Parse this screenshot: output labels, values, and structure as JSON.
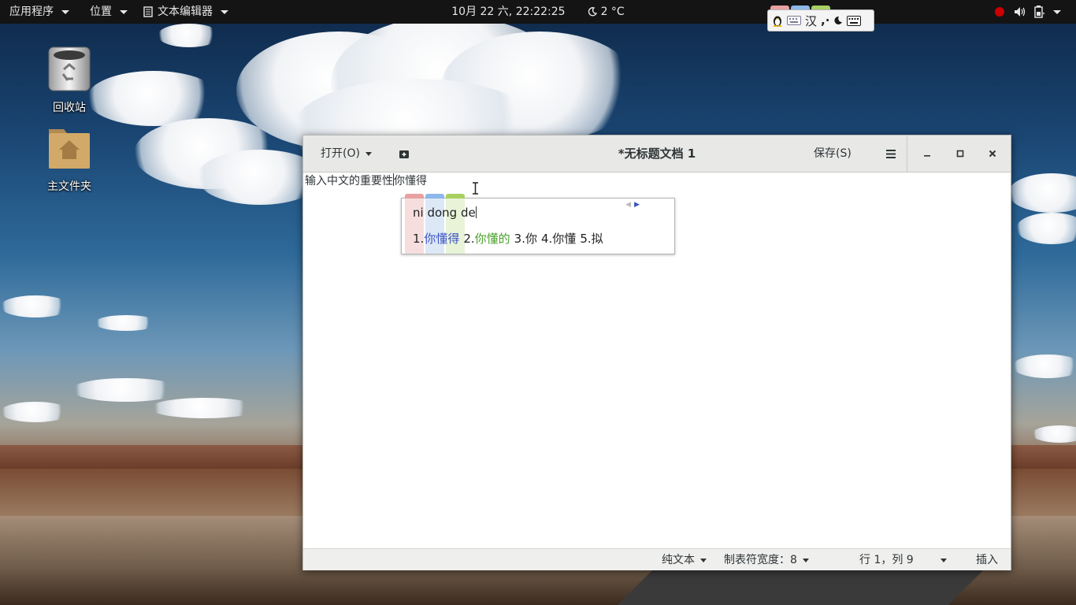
{
  "topbar": {
    "applications": "应用程序",
    "places": "位置",
    "app_name": "文本编辑器",
    "clock": "10月 22 六, 22:22:25",
    "weather": "2 °C",
    "colors": {
      "background": "#141414",
      "text": "#e8e8e8",
      "record": "#cc0000"
    }
  },
  "ime_toolbar": {
    "mode": "汉",
    "punct": ",·",
    "icons": [
      "penguin-icon",
      "soft-keyboard-icon",
      "moon-icon",
      "keyboard-icon"
    ]
  },
  "desktop": {
    "trash_label": "回收站",
    "home_label": "主文件夹"
  },
  "window": {
    "open_label": "打开(O)",
    "title": "*无标题文档 1",
    "save_label": "保存(S)"
  },
  "editor": {
    "text_before_cursor": "输入中文的重要性",
    "text_after_cursor": "你懂得"
  },
  "candidate_popup": {
    "preedit": "ni dong de",
    "candidates": [
      {
        "index": "1.",
        "text": "你懂得",
        "color": "#3a53c4"
      },
      {
        "index": "2.",
        "text": "你懂的",
        "color": "#4aa02c"
      },
      {
        "index": "3.",
        "text": "你",
        "color": "#222222"
      },
      {
        "index": "4.",
        "text": "你懂",
        "color": "#222222"
      },
      {
        "index": "5.",
        "text": "拟",
        "color": "#222222"
      }
    ],
    "stripe_colors": [
      "#f2c4c4",
      "#b8d4f2",
      "#d4ecb0"
    ]
  },
  "statusbar": {
    "language": "纯文本",
    "tab_width": "制表符宽度：8",
    "position": "行 1，列 9",
    "mode": "插入"
  }
}
